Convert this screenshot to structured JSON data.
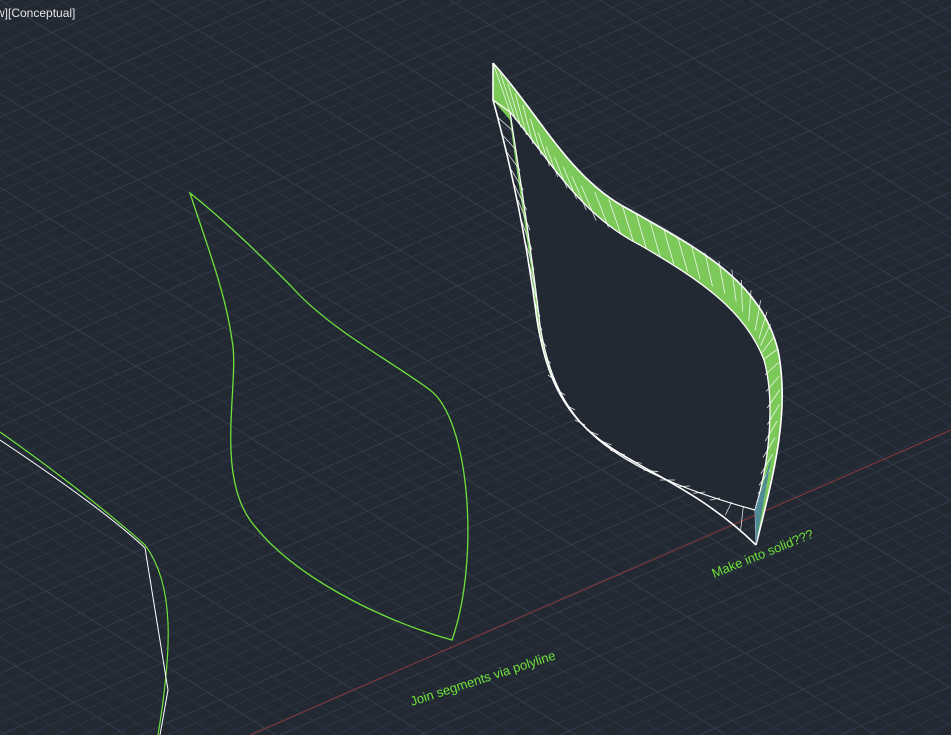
{
  "viewport": {
    "controls_label": "w][Conceptual]"
  },
  "annotations": {
    "polyline_note": "Join segments via polyline",
    "solid_note": "Make into solid???"
  },
  "colors": {
    "background": "#222933",
    "grid_minor": "#2c3440",
    "grid_major": "#333c49",
    "x_axis": "#8a3a3a",
    "curve": "#6fe23a",
    "surface_fill": "#7cc95a",
    "edge_white": "#ffffff",
    "annotation_text": "#6fe23a"
  }
}
